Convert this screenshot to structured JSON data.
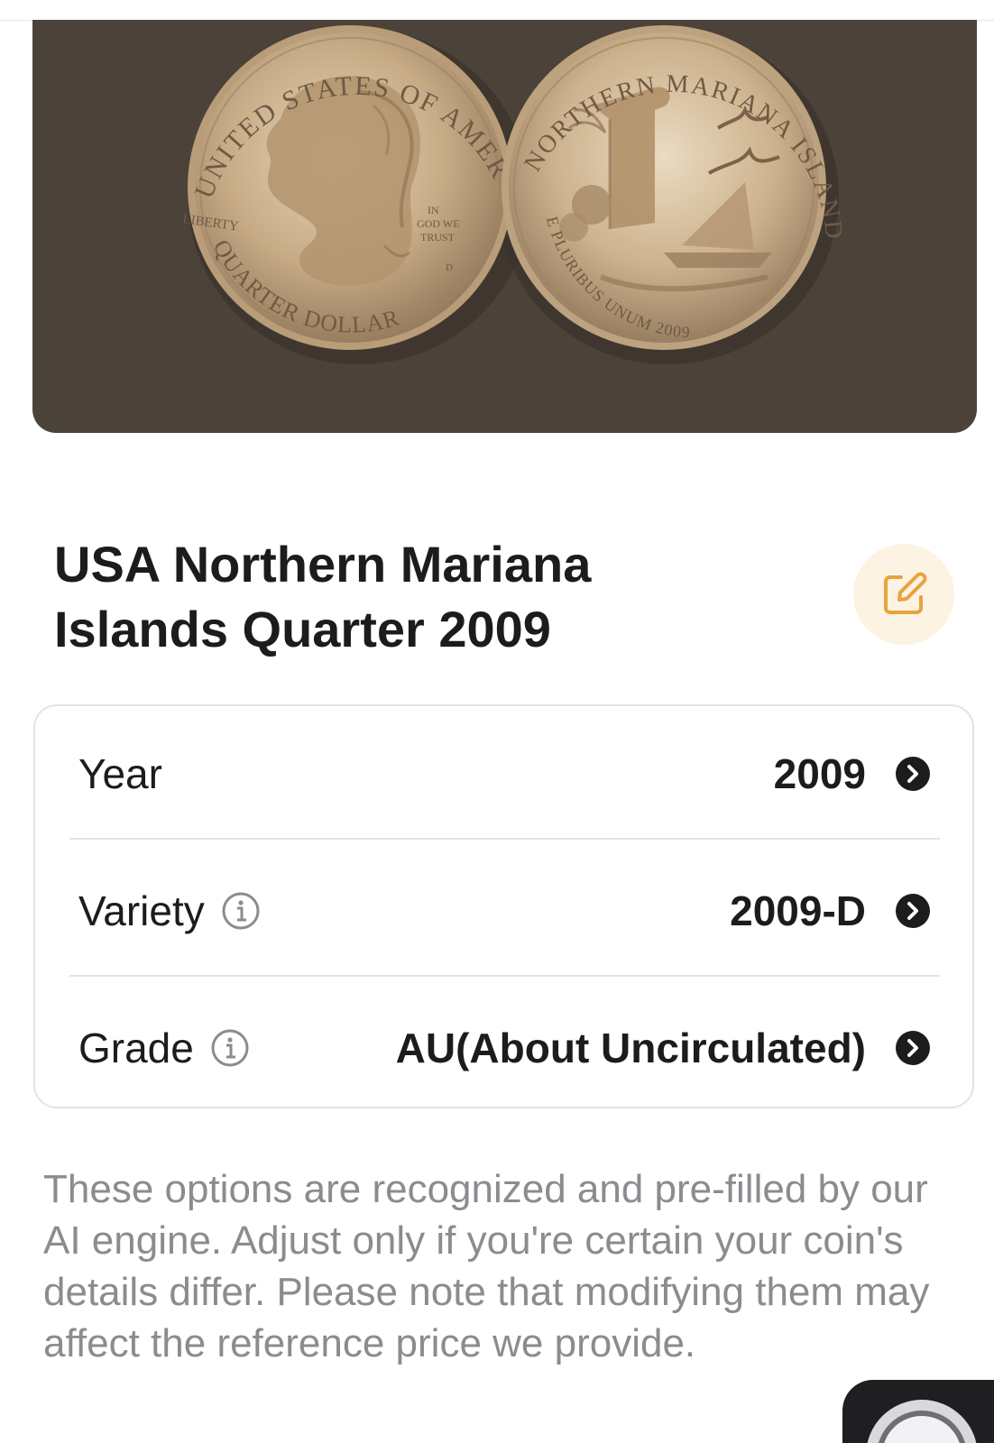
{
  "header": {
    "photo_alt": "Coin obverse and reverse photo"
  },
  "coin_photo": {
    "obverse": {
      "top_legend": "UNITED STATES OF AMERICA",
      "left_text": "LIBERTY",
      "motto_lines": [
        "IN",
        "GOD WE",
        "TRUST"
      ],
      "mint_mark": "D",
      "bottom_legend": "QUARTER DOLLAR"
    },
    "reverse": {
      "top_legend": "NORTHERN MARIANA ISLANDS",
      "bottom_legend": "E PLURIBUS UNUM 2009"
    }
  },
  "coin": {
    "title": "USA Northern Mariana\nIslands Quarter 2009"
  },
  "details": {
    "rows": [
      {
        "label": "Year",
        "value": "2009",
        "has_info": false
      },
      {
        "label": "Variety",
        "value": "2009-D",
        "has_info": true
      },
      {
        "label": "Grade",
        "value": "AU(About Uncirculated)",
        "has_info": true
      }
    ]
  },
  "disclaimer": "These options are recognized and pre-filled by our AI engine. Adjust only if you're certain your coin's details differ. Please note that modifying them may affect the reference price we provide.",
  "icons": {
    "edit": "edit-icon",
    "info": "info-icon",
    "chevron": "chevron-right-icon",
    "camera": "camera-shutter-icon"
  },
  "colors": {
    "accent": "#e8a33d",
    "edit_bg": "#fdf3e2",
    "photo_bg": "#4b423a",
    "text_primary": "#1c1c1e",
    "text_secondary": "#8b8b90",
    "border": "#e3e3e6"
  }
}
